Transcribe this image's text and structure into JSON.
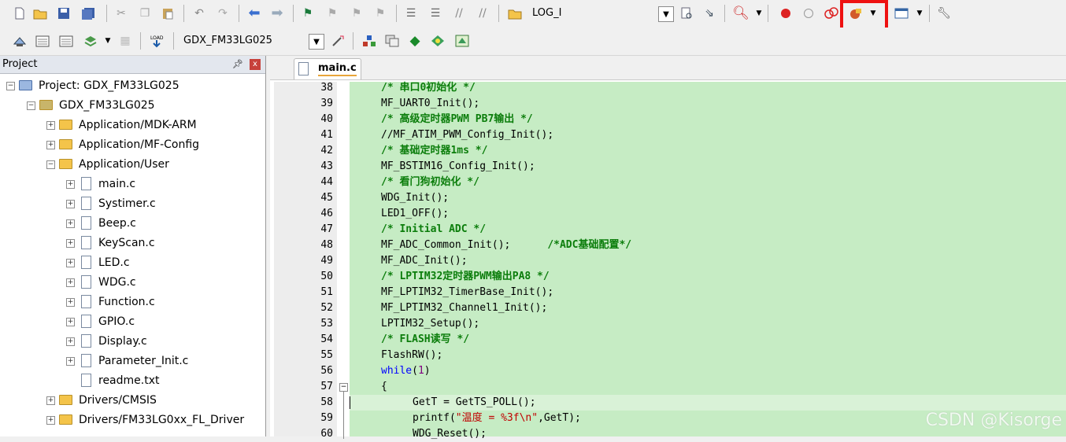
{
  "toolbar1": {
    "icons": [
      "new-file-icon",
      "open-file-icon",
      "save-icon",
      "save-all-icon",
      "cut-icon",
      "copy-icon",
      "paste-icon",
      "undo-icon",
      "redo-icon",
      "back-icon",
      "forward-icon",
      "bookmark-icon",
      "prev-bookmark-icon",
      "next-bookmark-icon",
      "clear-bookmarks-icon",
      "indent-icon",
      "unindent-icon",
      "comment-icon",
      "uncomment-icon",
      "find-in-files-icon"
    ],
    "search_value": "LOG_I",
    "right_icons": [
      "find-icon",
      "incremental-find-icon",
      "debug-icon",
      "breakpoint-icon",
      "disable-breakpoint-icon",
      "kill-breakpoints-icon",
      "configure-icon",
      "window-icon",
      "settings-icon"
    ]
  },
  "toolbar2": {
    "icons": [
      "translate-icon",
      "build-icon",
      "rebuild-icon",
      "batch-build-icon",
      "stop-build-icon",
      "download-icon"
    ],
    "target_value": "GDX_FM33LG025",
    "right_icons": [
      "target-options-icon",
      "manage-components-icon",
      "file-extensions-icon",
      "pack-installer-icon",
      "select-device-icon"
    ]
  },
  "project": {
    "title": "Project",
    "pin": "ꟸ",
    "close": "x",
    "tree": [
      {
        "label": "Project: GDX_FM33LG025",
        "indent": 0,
        "kind": "root",
        "exp": "-"
      },
      {
        "label": "GDX_FM33LG025",
        "indent": 1,
        "kind": "target",
        "exp": "-"
      },
      {
        "label": "Application/MDK-ARM",
        "indent": 2,
        "kind": "folder",
        "exp": "+"
      },
      {
        "label": "Application/MF-Config",
        "indent": 2,
        "kind": "folder",
        "exp": "+"
      },
      {
        "label": "Application/User",
        "indent": 2,
        "kind": "folder-open",
        "exp": "-"
      },
      {
        "label": "main.c",
        "indent": 3,
        "kind": "file",
        "exp": "+"
      },
      {
        "label": "Systimer.c",
        "indent": 3,
        "kind": "file",
        "exp": "+"
      },
      {
        "label": "Beep.c",
        "indent": 3,
        "kind": "file",
        "exp": "+"
      },
      {
        "label": "KeyScan.c",
        "indent": 3,
        "kind": "file",
        "exp": "+"
      },
      {
        "label": "LED.c",
        "indent": 3,
        "kind": "file",
        "exp": "+"
      },
      {
        "label": "WDG.c",
        "indent": 3,
        "kind": "file",
        "exp": "+"
      },
      {
        "label": "Function.c",
        "indent": 3,
        "kind": "file",
        "exp": "+"
      },
      {
        "label": "GPIO.c",
        "indent": 3,
        "kind": "file",
        "exp": "+"
      },
      {
        "label": "Display.c",
        "indent": 3,
        "kind": "file",
        "exp": "+"
      },
      {
        "label": "Parameter_Init.c",
        "indent": 3,
        "kind": "file",
        "exp": "+"
      },
      {
        "label": "readme.txt",
        "indent": 3,
        "kind": "file",
        "exp": ""
      },
      {
        "label": "Drivers/CMSIS",
        "indent": 2,
        "kind": "folder",
        "exp": "+"
      },
      {
        "label": "Drivers/FM33LG0xx_FL_Driver",
        "indent": 2,
        "kind": "folder",
        "exp": "+"
      }
    ]
  },
  "editor": {
    "tab_label": "main.c",
    "lines": [
      {
        "n": "38",
        "indent": 0,
        "parts": [
          [
            "cm",
            "/* 串口0初始化 */"
          ]
        ]
      },
      {
        "n": "39",
        "indent": 0,
        "parts": [
          [
            "fn",
            "MF_UART0_Init();"
          ]
        ]
      },
      {
        "n": "40",
        "indent": 0,
        "parts": [
          [
            "cm",
            "/* 高级定时器PWM PB7输出 */"
          ]
        ]
      },
      {
        "n": "41",
        "indent": 0,
        "parts": [
          [
            "fn",
            "//MF_ATIM_PWM_Config_Init();"
          ]
        ]
      },
      {
        "n": "42",
        "indent": 0,
        "parts": [
          [
            "cm",
            "/* 基础定时器1ms */"
          ]
        ]
      },
      {
        "n": "43",
        "indent": 0,
        "parts": [
          [
            "fn",
            "MF_BSTIM16_Config_Init();"
          ]
        ]
      },
      {
        "n": "44",
        "indent": 0,
        "parts": [
          [
            "cm",
            "/* 看门狗初始化 */"
          ]
        ]
      },
      {
        "n": "45",
        "indent": 0,
        "parts": [
          [
            "fn",
            "WDG_Init();"
          ]
        ]
      },
      {
        "n": "46",
        "indent": 0,
        "parts": [
          [
            "fn",
            "LED1_OFF();"
          ]
        ]
      },
      {
        "n": "47",
        "indent": 0,
        "parts": [
          [
            "cm",
            "/* Initial ADC */"
          ]
        ]
      },
      {
        "n": "48",
        "indent": 0,
        "parts": [
          [
            "fn",
            "MF_ADC_Common_Init();      "
          ],
          [
            "cm",
            "/*ADC基础配置*/"
          ]
        ]
      },
      {
        "n": "49",
        "indent": 0,
        "parts": [
          [
            "fn",
            "MF_ADC_Init();"
          ]
        ]
      },
      {
        "n": "50",
        "indent": 0,
        "parts": [
          [
            "cm",
            "/* LPTIM32定时器PWM输出PA8 */"
          ]
        ]
      },
      {
        "n": "51",
        "indent": 0,
        "parts": [
          [
            "fn",
            "MF_LPTIM32_TimerBase_Init();"
          ]
        ]
      },
      {
        "n": "52",
        "indent": 0,
        "parts": [
          [
            "fn",
            "MF_LPTIM32_Channel1_Init();"
          ]
        ]
      },
      {
        "n": "53",
        "indent": 0,
        "parts": [
          [
            "fn",
            "LPTIM32_Setup();"
          ]
        ]
      },
      {
        "n": "54",
        "indent": 0,
        "parts": [
          [
            "cm",
            "/* FLASH读写 */"
          ]
        ]
      },
      {
        "n": "55",
        "indent": 0,
        "parts": [
          [
            "fn",
            "FlashRW();"
          ]
        ]
      },
      {
        "n": "56",
        "indent": 0,
        "parts": [
          [
            "kw",
            "while"
          ],
          [
            "fn",
            "("
          ],
          [
            "nm",
            "1"
          ],
          [
            "fn",
            ")"
          ]
        ]
      },
      {
        "n": "57",
        "indent": 0,
        "parts": [
          [
            "fn",
            "{"
          ]
        ]
      },
      {
        "n": "58",
        "indent": 1,
        "parts": [
          [
            "fn",
            "GetT = GetTS_POLL();"
          ]
        ]
      },
      {
        "n": "59",
        "indent": 1,
        "parts": [
          [
            "fn",
            "printf("
          ],
          [
            "st",
            "\"温度 = %3f\\n\""
          ],
          [
            "fn",
            ",GetT);"
          ]
        ]
      },
      {
        "n": "60",
        "indent": 1,
        "parts": [
          [
            "fn",
            "WDG_Reset();"
          ]
        ]
      }
    ]
  },
  "watermark": "CSDN @Kisorge"
}
